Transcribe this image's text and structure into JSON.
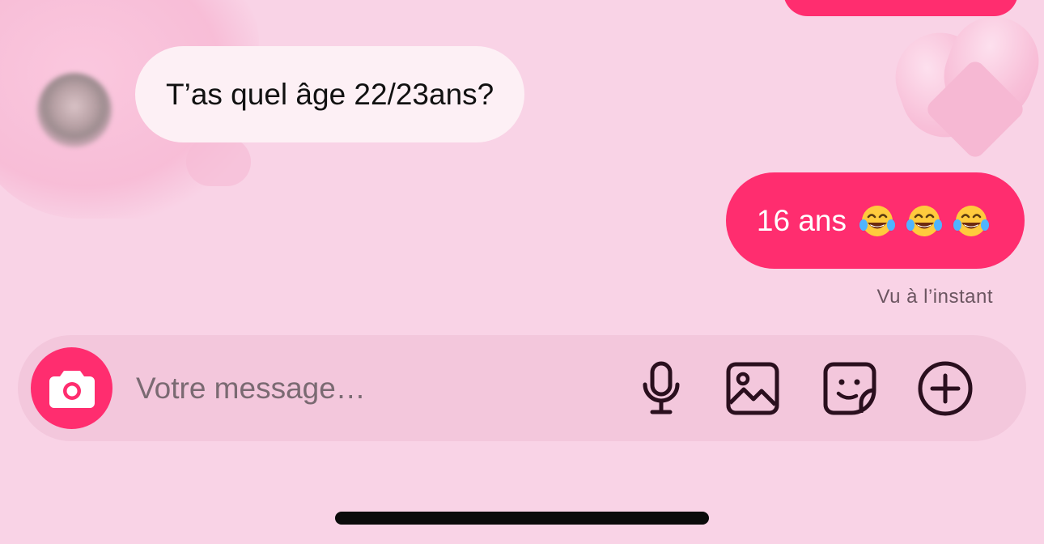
{
  "conversation": {
    "previous_bubble_color": "#ff2d6f",
    "incoming": {
      "text": "T’as quel âge 22/23ans?",
      "bubble_color": "#fdf0f5"
    },
    "outgoing": {
      "text": "16 ans",
      "emojis": [
        "face-with-tears-of-joy",
        "face-with-tears-of-joy",
        "face-with-tears-of-joy"
      ],
      "bubble_color": "#ff2d6f"
    },
    "seen_status": "Vu à l’instant"
  },
  "composer": {
    "placeholder": "Votre message…",
    "value": "",
    "camera_icon": "camera-icon",
    "tools": [
      "microphone-icon",
      "image-icon",
      "sticker-icon",
      "plus-circle-icon"
    ]
  },
  "colors": {
    "background": "#f9d3e6",
    "accent": "#ff2d6f",
    "icon": "#2a0f1e"
  }
}
